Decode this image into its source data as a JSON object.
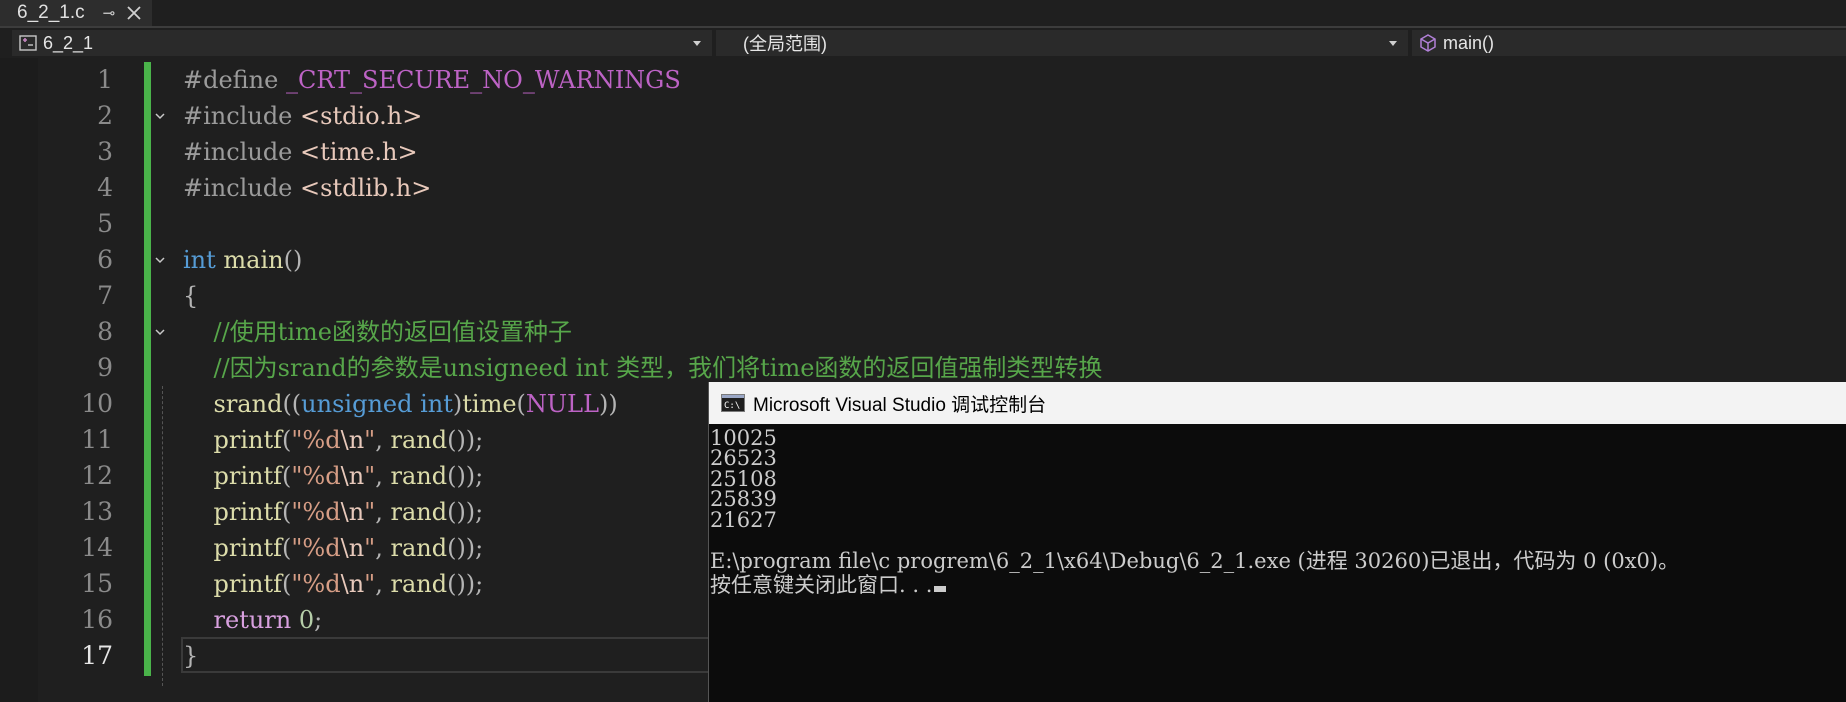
{
  "tab": {
    "title": "6_2_1.c"
  },
  "navbar": {
    "project": "6_2_1",
    "scope": "(全局范围)",
    "member": "main()"
  },
  "editor": {
    "current_line": 17,
    "lines": [
      {
        "num": "1",
        "parts": [
          [
            "pp",
            "#define "
          ],
          [
            "mac",
            "_CRT_SECURE_NO_WARNINGS"
          ]
        ]
      },
      {
        "num": "2",
        "fold": true,
        "parts": [
          [
            "pp",
            "#include "
          ],
          [
            "hdr",
            "<stdio.h>"
          ]
        ]
      },
      {
        "num": "3",
        "parts": [
          [
            "pp",
            "#include "
          ],
          [
            "hdr",
            "<time.h>"
          ]
        ]
      },
      {
        "num": "4",
        "parts": [
          [
            "pp",
            "#include "
          ],
          [
            "hdr",
            "<stdlib.h>"
          ]
        ]
      },
      {
        "num": "5",
        "parts": []
      },
      {
        "num": "6",
        "fold": true,
        "parts": [
          [
            "kw",
            "int"
          ],
          [
            "pun",
            " "
          ],
          [
            "fn",
            "main"
          ],
          [
            "pun",
            "()"
          ]
        ]
      },
      {
        "num": "7",
        "parts": [
          [
            "pun",
            "{"
          ]
        ]
      },
      {
        "num": "8",
        "fold": true,
        "parts": [
          [
            "pun",
            "    "
          ],
          [
            "cm",
            "//使用time函数的返回值设置种子"
          ]
        ]
      },
      {
        "num": "9",
        "parts": [
          [
            "pun",
            "    "
          ],
          [
            "cm",
            "//因为srand的参数是unsigneed int 类型，我们将time函数的返回值强制类型转换"
          ]
        ]
      },
      {
        "num": "10",
        "parts": [
          [
            "pun",
            "    "
          ],
          [
            "fn",
            "srand"
          ],
          [
            "pun",
            "(("
          ],
          [
            "kw",
            "unsigned int"
          ],
          [
            "pun",
            ")"
          ],
          [
            "fn",
            "time"
          ],
          [
            "pun",
            "("
          ],
          [
            "mac",
            "NULL"
          ],
          [
            "pun",
            "))"
          ]
        ]
      },
      {
        "num": "11",
        "parts": [
          [
            "pun",
            "    "
          ],
          [
            "fn",
            "printf"
          ],
          [
            "pun",
            "("
          ],
          [
            "str",
            "\"%d"
          ],
          [
            "esc",
            "\\n"
          ],
          [
            "str",
            "\""
          ],
          [
            "pun",
            ", "
          ],
          [
            "fn",
            "rand"
          ],
          [
            "pun",
            "());"
          ]
        ]
      },
      {
        "num": "12",
        "parts": [
          [
            "pun",
            "    "
          ],
          [
            "fn",
            "printf"
          ],
          [
            "pun",
            "("
          ],
          [
            "str",
            "\"%d"
          ],
          [
            "esc",
            "\\n"
          ],
          [
            "str",
            "\""
          ],
          [
            "pun",
            ", "
          ],
          [
            "fn",
            "rand"
          ],
          [
            "pun",
            "());"
          ]
        ]
      },
      {
        "num": "13",
        "parts": [
          [
            "pun",
            "    "
          ],
          [
            "fn",
            "printf"
          ],
          [
            "pun",
            "("
          ],
          [
            "str",
            "\"%d"
          ],
          [
            "esc",
            "\\n"
          ],
          [
            "str",
            "\""
          ],
          [
            "pun",
            ", "
          ],
          [
            "fn",
            "rand"
          ],
          [
            "pun",
            "());"
          ]
        ]
      },
      {
        "num": "14",
        "parts": [
          [
            "pun",
            "    "
          ],
          [
            "fn",
            "printf"
          ],
          [
            "pun",
            "("
          ],
          [
            "str",
            "\"%d"
          ],
          [
            "esc",
            "\\n"
          ],
          [
            "str",
            "\""
          ],
          [
            "pun",
            ", "
          ],
          [
            "fn",
            "rand"
          ],
          [
            "pun",
            "());"
          ]
        ]
      },
      {
        "num": "15",
        "parts": [
          [
            "pun",
            "    "
          ],
          [
            "fn",
            "printf"
          ],
          [
            "pun",
            "("
          ],
          [
            "str",
            "\"%d"
          ],
          [
            "esc",
            "\\n"
          ],
          [
            "str",
            "\""
          ],
          [
            "pun",
            ", "
          ],
          [
            "fn",
            "rand"
          ],
          [
            "pun",
            "());"
          ]
        ]
      },
      {
        "num": "16",
        "parts": [
          [
            "pun",
            "    "
          ],
          [
            "ctl",
            "return"
          ],
          [
            "pun",
            " "
          ],
          [
            "num",
            "0"
          ],
          [
            "pun",
            ";"
          ]
        ]
      },
      {
        "num": "17",
        "parts": [
          [
            "pun",
            "}"
          ]
        ]
      }
    ]
  },
  "console": {
    "title": "Microsoft Visual Studio 调试控制台",
    "lines": [
      "10025",
      "26523",
      "25108",
      "25839",
      "21627",
      "",
      "E:\\program file\\c progrem\\6_2_1\\x64\\Debug\\6_2_1.exe (进程 30260)已退出，代码为 0 (0x0)。",
      "按任意键关闭此窗口. . ."
    ]
  },
  "colors": {
    "background": "#1f1f1f",
    "keyword": "#569cd6",
    "comment": "#57a64a",
    "function": "#dcdcaa",
    "string": "#d69d85",
    "macro": "#bd63c5",
    "change_bar": "#4ab34a",
    "console_bg": "#0c0c0c"
  },
  "icons": {
    "tab_pin": "pin-icon",
    "tab_close": "close-icon",
    "project": "project-icon",
    "member": "method-icon",
    "console": "console-icon"
  }
}
